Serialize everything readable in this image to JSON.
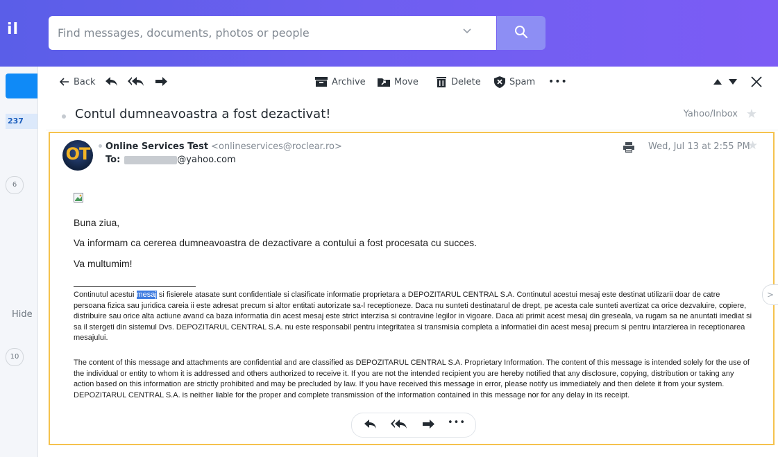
{
  "header": {
    "logo_text": "il",
    "search": {
      "placeholder": "Find messages, documents, photos or people"
    }
  },
  "left_rail": {
    "inbox_count": "237",
    "badge_1": "6",
    "hide_label": "Hide",
    "badge_2": "10"
  },
  "toolbar": {
    "back_label": "Back",
    "archive_label": "Archive",
    "move_label": "Move",
    "delete_label": "Delete",
    "spam_label": "Spam",
    "more_label": "•••"
  },
  "message": {
    "subject": "Contul dumneavoastra a fost dezactivat!",
    "folder": "Yahoo/Inbox",
    "sender_name": "Online Services Test",
    "sender_email": "<onlineservices@roclear.ro>",
    "to_label": "To:",
    "to_address_visible": "@yahoo.com",
    "date": "Wed, Jul 13 at 2:55 PM",
    "avatar_initials": "OT",
    "greeting": "Buna ziua,",
    "body_line": "Va informam ca cererea dumneavoastra de dezactivare a contului a fost procesata cu succes.",
    "closing": "Va multumim!",
    "disclaimer_ro_prefix": "Continutul acestui ",
    "disclaimer_ro_highlight": "mesaj",
    "disclaimer_ro_rest": " si fisierele atasate sunt confidentiale si clasificate informatie proprietara a DEPOZITARUL CENTRAL S.A. Continutul acestui mesaj este destinat utilizarii doar de catre persoana fizica sau juridica careia ii este adresat precum si altor entitati autorizate sa-l receptioneze. Daca nu sunteti destinatarul de drept, pe acesta cale sunteti avertizat ca orice dezvaluire, copiere, distribuire sau orice alta actiune avand ca baza informatia din acest mesaj este strict interzisa si contravine legilor in vigoare. Daca ati primit acest mesaj din greseala, va rugam sa ne anuntati imediat si sa il stergeti din sistemul Dvs. DEPOZITARUL CENTRAL S.A. nu este responsabil pentru integritatea si transmisia completa a informatiei din acest mesaj precum si pentru intarzierea in receptionarea mesajului.",
    "disclaimer_en": "The content of this message and attachments are confidential and are classified as DEPOZITARUL CENTRAL S.A. Proprietary Information. The content of this message is intended solely for the use of the individual or entity to whom it is addressed and others authorized to receive it. If you are not the intended recipient you are hereby notified that any disclosure, copying, distribution or taking any action based on this information are strictly prohibited and may be precluded by law. If you have received this message in error, please notify us immediately and then delete it from your system. DEPOZITARUL CENTRAL S.A. is neither liable for the proper and complete transmission of the information contained in this message nor for any delay in its receipt."
  },
  "reply_bar": {
    "more_label": "•••"
  },
  "colors": {
    "header_gradient_start": "#5a5ee8",
    "header_gradient_end": "#7c5cf5",
    "search_button": "#8d8ef4",
    "accent_blue": "#0f8af7",
    "card_border": "#f5c24d",
    "selection_highlight": "#3d7be0"
  },
  "icons": [
    "search-icon",
    "chevron-down-icon",
    "back-arrow-icon",
    "reply-icon",
    "reply-all-icon",
    "forward-icon",
    "archive-icon",
    "move-icon",
    "delete-icon",
    "spam-shield-icon",
    "more-icon",
    "previous-message-icon",
    "next-message-icon",
    "close-icon",
    "star-icon",
    "print-icon",
    "broken-image-icon"
  ]
}
